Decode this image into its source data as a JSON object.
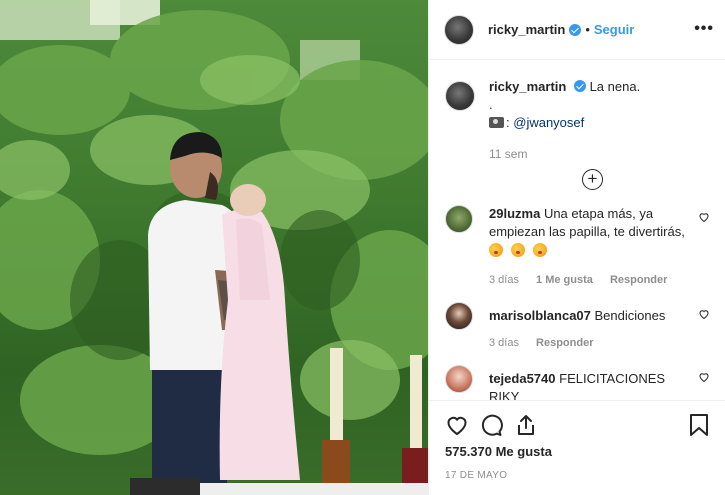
{
  "post": {
    "username": "ricky_martin",
    "follow_label": "Seguir",
    "separator": "•",
    "more_label": "•••"
  },
  "caption": {
    "username": "ricky_martin",
    "text": "La nena.",
    "dot": ".",
    "credit_prefix": ":",
    "credit_link": "@jwanyosef",
    "time": "11 sem"
  },
  "load_more_label": "+",
  "comments": [
    {
      "username": "29luzma",
      "text": "Una etapa más, ya empiezan las papilla, te divertirás,",
      "time": "3 días",
      "likes": "1 Me gusta",
      "reply": "Responder"
    },
    {
      "username": "marisolblanca07",
      "text": "Bendiciones",
      "time": "3 días",
      "reply": "Responder"
    },
    {
      "username": "tejeda5740",
      "text": "FELICITACIONES RIKY"
    }
  ],
  "footer": {
    "likes": "575.370 Me gusta",
    "date": "17 DE MAYO"
  },
  "colors": {
    "accent": "#3897f0",
    "text": "#262626",
    "muted": "#8e8e8e"
  },
  "icons": [
    "heart-icon",
    "comment-icon",
    "share-icon",
    "bookmark-icon"
  ]
}
